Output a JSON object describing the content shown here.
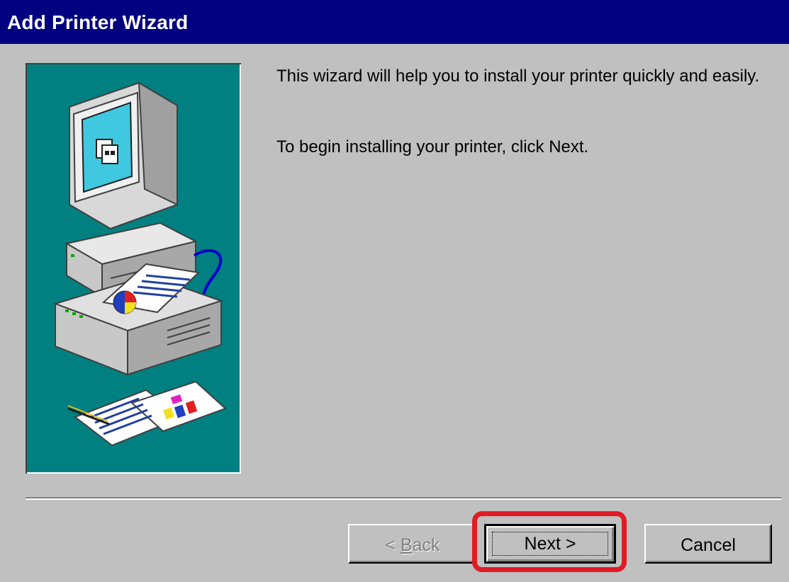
{
  "window": {
    "title": "Add Printer Wizard"
  },
  "content": {
    "intro": "This wizard will help you to install your printer quickly and easily.",
    "instruction": "To begin installing your printer, click Next."
  },
  "graphic": {
    "icons": [
      "computer-icon",
      "printer-icon",
      "documents-icon"
    ],
    "background_color": "#008080"
  },
  "buttons": {
    "back": {
      "prefix": "< ",
      "mnemonic": "B",
      "rest": "ack",
      "enabled": false
    },
    "next": {
      "label": "Next >",
      "enabled": true,
      "focused": true
    },
    "cancel": {
      "label": "Cancel",
      "enabled": true
    }
  },
  "colors": {
    "titlebar": "#000080",
    "dialog": "#c0c0c0",
    "highlight": "#e11b24"
  }
}
